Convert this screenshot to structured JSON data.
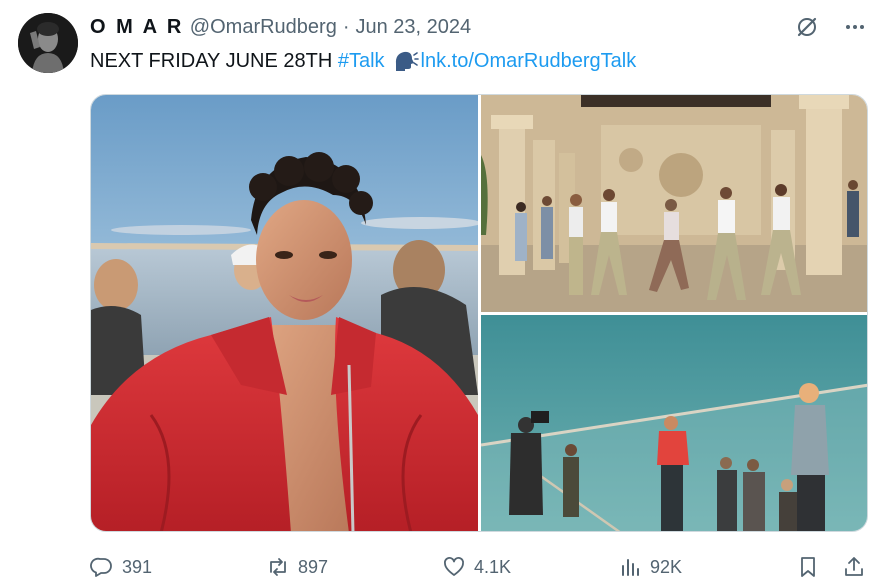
{
  "author": {
    "name": "O M A R",
    "handle": "@OmarRudberg",
    "separator": "·",
    "date": "Jun 23, 2024"
  },
  "tweet": {
    "text": "NEXT FRIDAY JUNE 28TH",
    "hashtag": "#Talk",
    "emoji": "speaking-head-emoji",
    "link": "lnk.to/OmarRudbergTalk"
  },
  "header_icons": [
    "grok-icon",
    "more-icon"
  ],
  "media": [
    {
      "name": "photo-portrait-red-jacket"
    },
    {
      "name": "photo-dancers-colonnade"
    },
    {
      "name": "photo-rooftop-filming"
    }
  ],
  "metrics": {
    "replies": "391",
    "reposts": "897",
    "likes": "4.1K",
    "views": "92K"
  },
  "colors": {
    "text": "#0f1419",
    "secondary": "#536471",
    "link": "#1d9bf0",
    "jacket_red": "#d12a2f"
  }
}
